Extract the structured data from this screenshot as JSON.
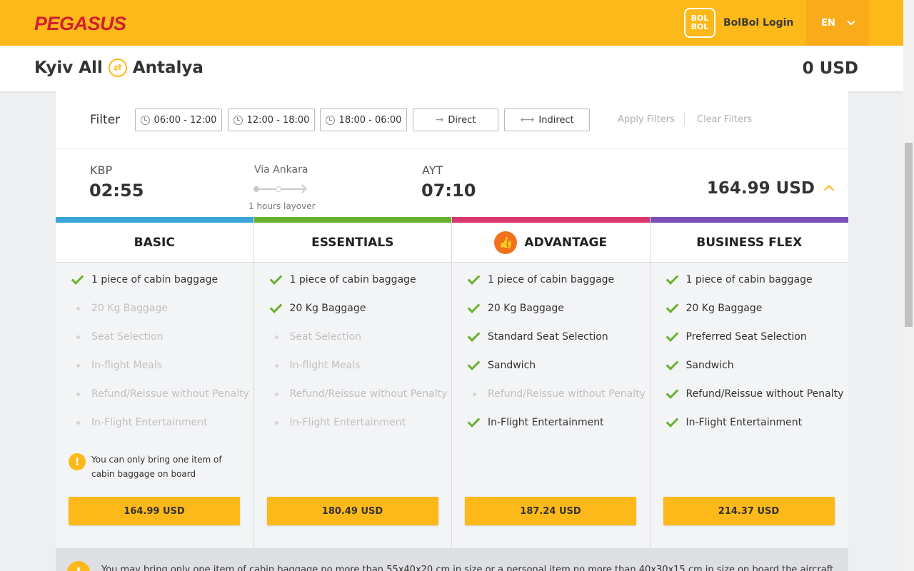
{
  "header": {
    "logo": "PEGASUS",
    "bolbol_badge": [
      "BOL",
      "BOL"
    ],
    "bolbol_login": "BolBol Login",
    "language": "EN"
  },
  "route": {
    "origin": "Kyiv All",
    "destination": "Antalya",
    "total": "0 USD"
  },
  "filter": {
    "label": "Filter",
    "buttons": [
      "06:00 - 12:00",
      "12:00 - 18:00",
      "18:00 - 06:00",
      "Direct",
      "Indirect"
    ],
    "apply": "Apply Filters",
    "clear": "Clear Filters"
  },
  "flight": {
    "from_code": "KBP",
    "from_time": "02:55",
    "via": "Via Ankara",
    "layover": "1 hours layover",
    "to_code": "AYT",
    "to_time": "07:10",
    "price": "164.99 USD"
  },
  "fares": [
    {
      "name": "BASIC",
      "color": "#3aa6d8",
      "features": [
        {
          "label": "1 piece of cabin baggage",
          "included": true
        },
        {
          "label": "20 Kg Baggage",
          "included": false
        },
        {
          "label": "Seat Selection",
          "included": false
        },
        {
          "label": "In-flight Meals",
          "included": false
        },
        {
          "label": "Refund/Reissue without Penalty",
          "included": false
        },
        {
          "label": "In-Flight Entertainment",
          "included": false
        }
      ],
      "warning": "You can only bring one item of cabin baggage on board",
      "price": "164.99 USD"
    },
    {
      "name": "ESSENTIALS",
      "color": "#6ab12f",
      "features": [
        {
          "label": "1 piece of cabin baggage",
          "included": true
        },
        {
          "label": "20 Kg Baggage",
          "included": true
        },
        {
          "label": "Seat Selection",
          "included": false
        },
        {
          "label": "In-flight Meals",
          "included": false
        },
        {
          "label": "Refund/Reissue without Penalty",
          "included": false
        },
        {
          "label": "In-Flight Entertainment",
          "included": false
        }
      ],
      "price": "180.49 USD"
    },
    {
      "name": "ADVANTAGE",
      "color": "#d9396e",
      "recommended_icon": "thumbs-up-icon",
      "features": [
        {
          "label": "1 piece of cabin baggage",
          "included": true
        },
        {
          "label": "20 Kg Baggage",
          "included": true
        },
        {
          "label": "Standard Seat Selection",
          "included": true
        },
        {
          "label": "Sandwich",
          "included": true
        },
        {
          "label": "Refund/Reissue without Penalty",
          "included": false
        },
        {
          "label": "In-Flight Entertainment",
          "included": true
        }
      ],
      "price": "187.24 USD"
    },
    {
      "name": "BUSINESS FLEX",
      "color": "#7b4fb7",
      "features": [
        {
          "label": "1 piece of cabin baggage",
          "included": true
        },
        {
          "label": "20 Kg Baggage",
          "included": true
        },
        {
          "label": "Preferred Seat Selection",
          "included": true
        },
        {
          "label": "Sandwich",
          "included": true
        },
        {
          "label": "Refund/Reissue without Penalty",
          "included": true
        },
        {
          "label": "In-Flight Entertainment",
          "included": true
        }
      ],
      "price": "214.37 USD"
    }
  ],
  "notice": "You may bring only one item of cabin baggage no more than 55x40x20 cm in size or a personal item no more than 40x30x15 cm in size on board the aircraft."
}
